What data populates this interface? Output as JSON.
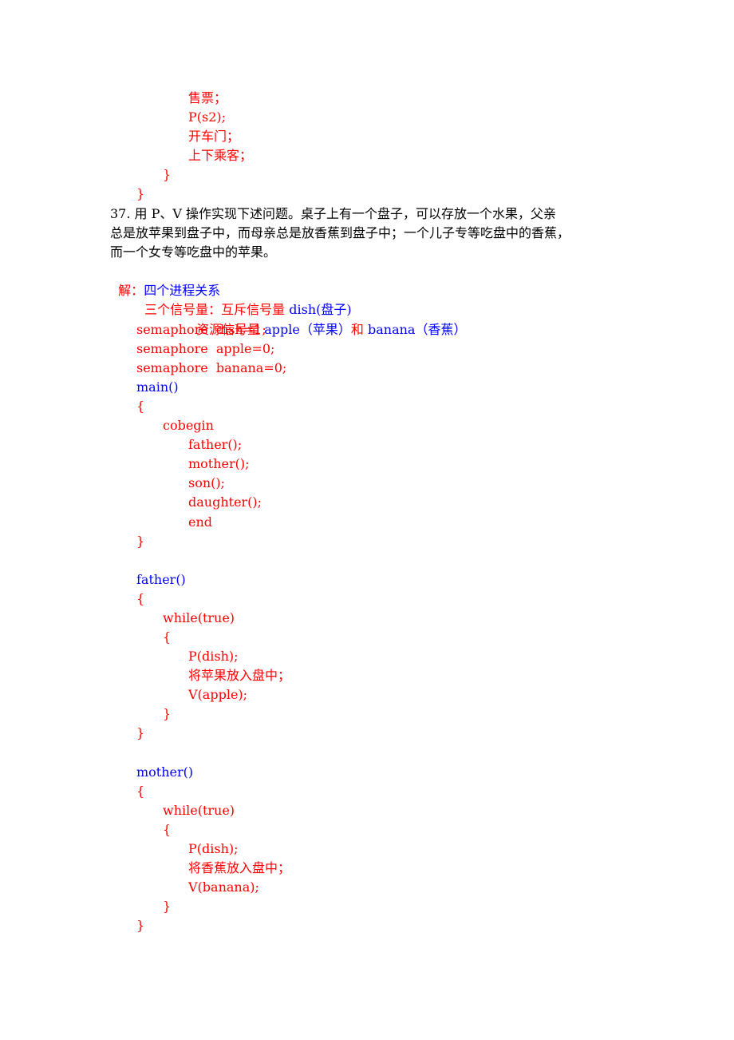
{
  "colors": {
    "red": "#ff0000",
    "blue": "#0000ff",
    "black": "#000000"
  },
  "prev_tail": {
    "lines": [
      "售票；",
      "P(s2);",
      "开车门；",
      "上下乘客；",
      "}",
      "}"
    ]
  },
  "question": {
    "number": "37.",
    "lines": [
      "37. 用 P、V 操作实现下述问题。桌子上有一个盘子，可以存放一个水果，父亲",
      "总是放苹果到盘子中，而母亲总是放香蕉到盘子中；一个儿子专等吃盘中的香蕉，",
      "而一个女专等吃盘中的苹果。"
    ]
  },
  "answer": {
    "label": "解：",
    "intro": "四个进程关系",
    "sem_line1": {
      "a": "三个信号量：互斥信号量 ",
      "b": "dish(盘子)"
    },
    "sem_line2": {
      "a": "资源信号量 ",
      "b": "apple（苹果）",
      "c": "和 ",
      "d": "banana（香蕉）"
    },
    "decls": [
      "semaphore  dish=1;",
      "semaphore  apple=0;",
      "semaphore  banana=0;"
    ],
    "main": {
      "name": "main()",
      "open": "{",
      "cobegin": "cobegin",
      "calls": [
        "father();",
        "mother();",
        "son();",
        "daughter();"
      ],
      "end": "end",
      "close": "}"
    },
    "father": {
      "name": "father()",
      "open": "{",
      "loop": "while(true)",
      "loop_open": "{",
      "body": [
        "P(dish);",
        "将苹果放入盘中；",
        "V(apple);"
      ],
      "loop_close": "}",
      "close": "}"
    },
    "mother": {
      "name": "mother()",
      "open": "{",
      "loop": "while(true)",
      "loop_open": "{",
      "body": [
        "P(dish);",
        "将香蕉放入盘中；",
        "V(banana);"
      ],
      "loop_close": "}",
      "close": "}"
    }
  }
}
